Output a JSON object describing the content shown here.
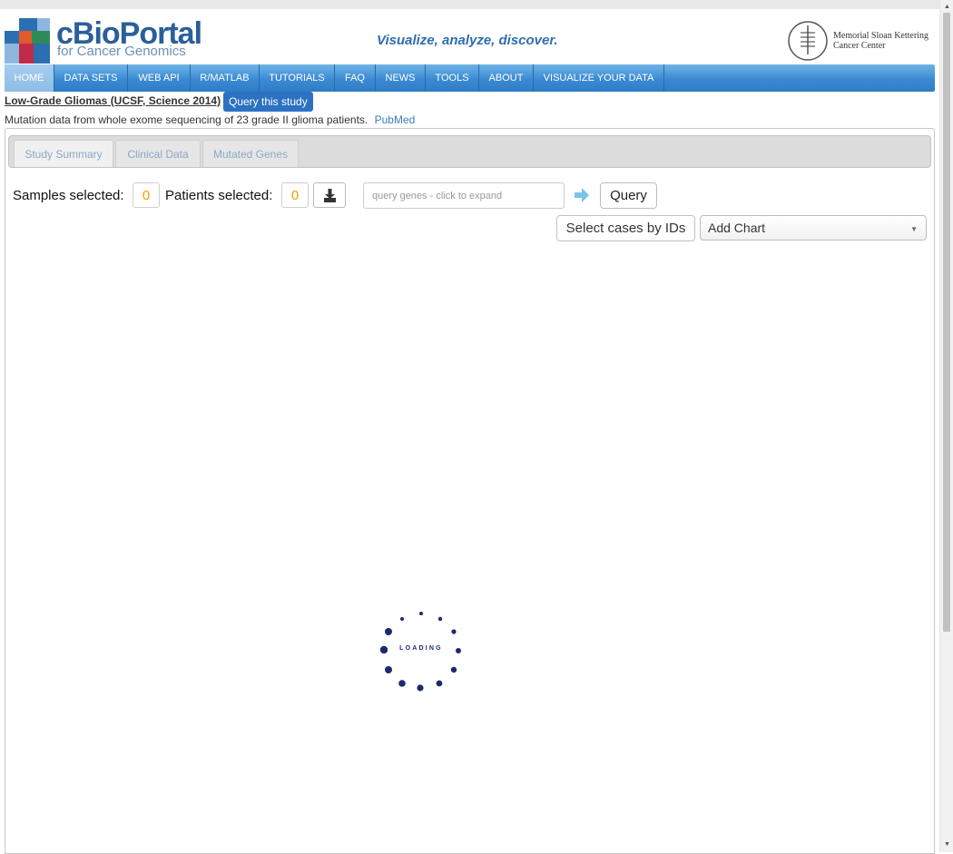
{
  "header": {
    "logo": {
      "title": "cBioPortal",
      "subtitle": "for Cancer Genomics"
    },
    "tagline": "Visualize, analyze, discover.",
    "partner_logo": {
      "line1": "Memorial Sloan Kettering",
      "line2": "Cancer Center"
    }
  },
  "nav": {
    "items": [
      {
        "label": "HOME",
        "active": true
      },
      {
        "label": "DATA SETS"
      },
      {
        "label": "WEB API"
      },
      {
        "label": "R/MATLAB"
      },
      {
        "label": "TUTORIALS"
      },
      {
        "label": "FAQ"
      },
      {
        "label": "NEWS"
      },
      {
        "label": "TOOLS"
      },
      {
        "label": "ABOUT"
      },
      {
        "label": "VISUALIZE YOUR DATA"
      }
    ]
  },
  "study": {
    "title": "Low-Grade Gliomas (UCSF, Science 2014)",
    "query_button": "Query this study",
    "description": "Mutation data from whole exome sequencing of 23 grade II glioma patients.",
    "pubmed_link": "PubMed"
  },
  "tabs": [
    {
      "label": "Study Summary",
      "active": true
    },
    {
      "label": "Clinical Data"
    },
    {
      "label": "Mutated Genes"
    }
  ],
  "selection": {
    "samples_label": "Samples selected:",
    "samples_count": "0",
    "patients_label": "Patients selected:",
    "patients_count": "0",
    "download_icon": "download-icon"
  },
  "gene_query": {
    "placeholder": "query genes - click to expand",
    "value": "",
    "go_icon": "arrow-right-icon",
    "query_button": "Query"
  },
  "controls": {
    "select_cases_button": "Select cases by IDs",
    "add_chart_label": "Add Chart"
  },
  "loading": {
    "text": "LOADING"
  },
  "colors": {
    "brand_blue": "#2a5f9b",
    "nav_blue": "#3a8ad3",
    "count_orange": "#f0a000",
    "loader_navy": "#1a2a6e"
  }
}
